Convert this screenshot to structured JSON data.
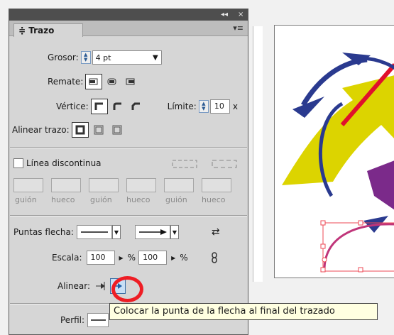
{
  "colors": {
    "panel_bg": "#d6d6d6",
    "highlight_ring": "#ee1d24",
    "tooltip_bg": "#ffffe1",
    "art_yellow": "#dcd400",
    "art_navy": "#2a3a8f",
    "art_purple": "#7b2a8a",
    "art_red": "#e0102c"
  },
  "panel": {
    "tab_label": "≑ Trazo",
    "weight_label": "Grosor:",
    "weight_value": "4 pt",
    "cap_label": "Remate:",
    "corner_label": "Vértice:",
    "limit_label": "Límite:",
    "limit_value": "10",
    "limit_unit": "x",
    "align_stroke_label": "Alinear trazo:",
    "dashed_label": "Línea discontinua",
    "dash_labels": [
      "guión",
      "hueco",
      "guión",
      "hueco",
      "guión",
      "hueco"
    ],
    "arrowheads_label": "Puntas flecha:",
    "scale_label": "Escala:",
    "scale_start": "100",
    "scale_end": "100",
    "percent": "%",
    "align_label": "Alinear:",
    "profile_label": "Perfil:"
  },
  "tooltip": {
    "text": "Colocar la punta de la flecha al final del trazado"
  },
  "icons": {
    "collapse": "◂◂",
    "close": "×",
    "panel_menu": "▾≡",
    "swap": "⇄",
    "link": "chain-link-icon"
  }
}
